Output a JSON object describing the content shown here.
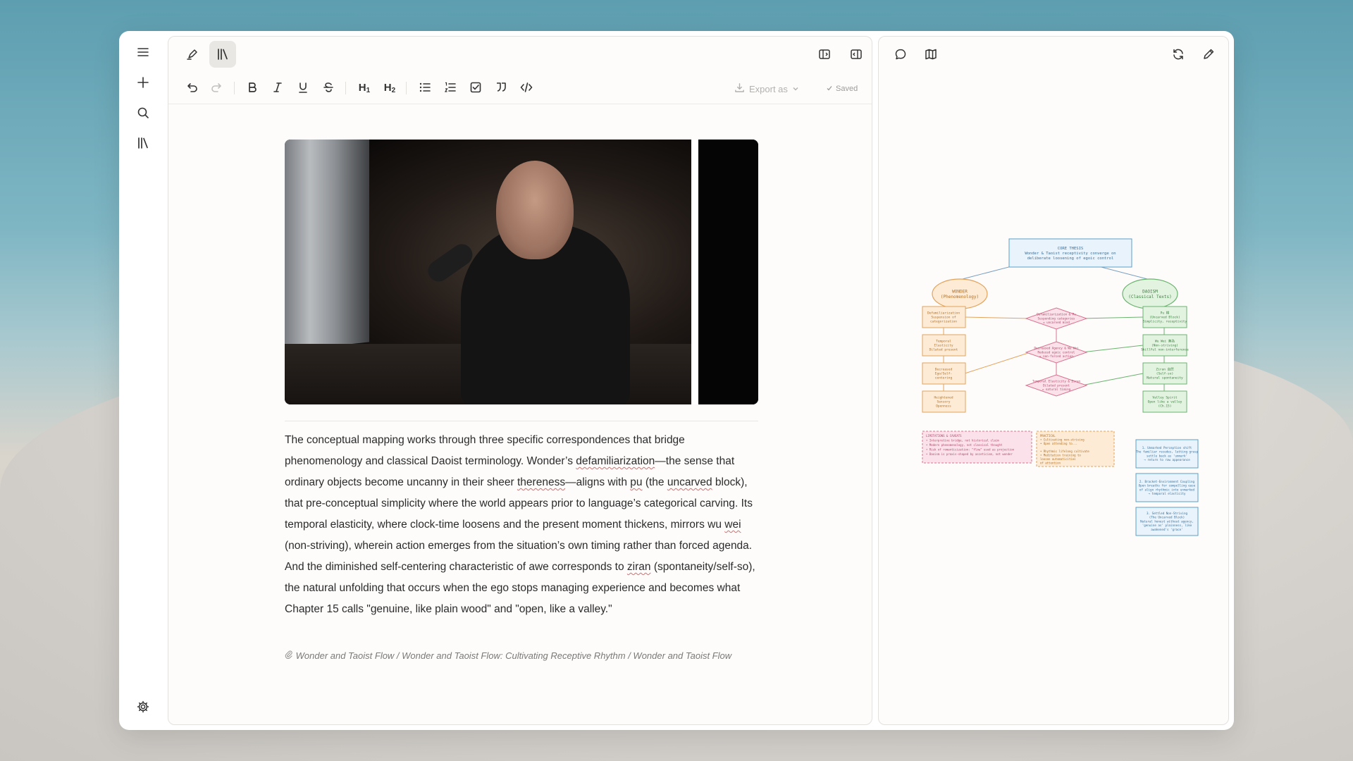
{
  "toolbar": {
    "export_label": "Export as",
    "saved_label": "Saved"
  },
  "document": {
    "paragraph": [
      {
        "t": "The conceptual mapping works through three specific correspondences that bridge phenomenology and classical Daoist terminology. Wonder’s "
      },
      {
        "t": "defamiliarization",
        "sq": true
      },
      {
        "t": "—the sense that ordinary objects become uncanny in their sheer "
      },
      {
        "t": "thereness",
        "sq": true
      },
      {
        "t": "—aligns with "
      },
      {
        "t": "pu",
        "sq": true
      },
      {
        "t": " (the "
      },
      {
        "t": "uncarved",
        "sq": true
      },
      {
        "t": " block), that pre-conceptual simplicity where the world appears prior to language’s categorical carving. Its temporal elasticity, where clock-time loosens and the present moment thickens, mirrors wu "
      },
      {
        "t": "wei",
        "sq": true
      },
      {
        "t": " (non-striving), wherein action emerges from the situation’s own timing rather than forced agenda. And the diminished self-centering characteristic of awe corresponds to "
      },
      {
        "t": "ziran",
        "sq": true
      },
      {
        "t": " (spontaneity/self-so), the natural unfolding that occurs when the ego stops managing experience and becomes what Chapter 15 calls \"genuine, like plain wood\" and \"open, like a valley.\""
      }
    ],
    "citation_icon": "paperclip-icon",
    "citation": "Wonder and Taoist Flow / Wonder and Taoist Flow: Cultivating Receptive Rhythm / Wonder and Taoist Flow"
  },
  "mindmap": {
    "core": [
      "CORE THESIS",
      "Wonder & Taoist receptivity converge on",
      "deliberate loosening of egoic control"
    ],
    "wonder": [
      "WONDER",
      "(Phenomenology)"
    ],
    "daoism": [
      "DAOISM",
      "(Classical Texts)"
    ],
    "left_nodes": [
      [
        "Defamiliarization",
        "Suspension of",
        "categorization"
      ],
      [
        "Temporal",
        "Elasticity",
        "Dilated present"
      ],
      [
        "Decreased",
        "Ego/Self-",
        "centering"
      ],
      [
        "Heightened",
        "Sensory",
        "Openness"
      ]
    ],
    "diamonds": [
      [
        "Defamiliarization & Pu",
        "Suspending categories",
        "= uncarved mind"
      ],
      [
        "Decreased Agency & Wu Wei",
        "Reduced egoic control",
        "= non-forced action"
      ],
      [
        "Temporal Elasticity & Ziran",
        "Dilated present",
        "= natural timing"
      ]
    ],
    "right_nodes": [
      [
        "Pu 樸",
        "(Uncarved Block)",
        "Simplicity, receptivity"
      ],
      [
        "Wu Wei 無為",
        "(Non-striving)",
        "Skillful non-interference"
      ],
      [
        "Ziran 自然",
        "(Self-so)",
        "Natural spontaneity"
      ],
      [
        "Valley Spirit",
        "Open like a valley",
        "(Ch.15)"
      ]
    ],
    "note_pink": [
      "LIMITATIONS & CAVEATS",
      "• Interpretive bridge, not historical claim",
      "• Modern phenomenology, not classical thought",
      "• Risk of romanticization: \"flow\" used as projection",
      "• Daoism is praxis-shaped by asceticism, not wonder"
    ],
    "note_orange": [
      "PRACTICAL",
      "• Cultivating non-striving",
      "• Open attending to...",
      "",
      "• Rhythmic lifelong cultivate",
      "• Meditation training to",
      "  loosen automaticities",
      "  of attention"
    ],
    "blue_nodes": [
      [
        "1. Unmarked Perception shift",
        "The familiar recedes, letting grasp",
        "settle back as 'unmark'",
        "→ return to raw appearance"
      ],
      [
        "2. Bracket-Environment Coupling",
        "Open breaths for compelling ease",
        "of align rhythmic into unmarked",
        "→ temporal elasticity"
      ],
      [
        "3. Settled Non-Striving",
        "(The Uncarved Block)",
        "Natural honest without agency,",
        "'genuine as' plainness, like",
        "awakened's 'grace'"
      ]
    ]
  }
}
